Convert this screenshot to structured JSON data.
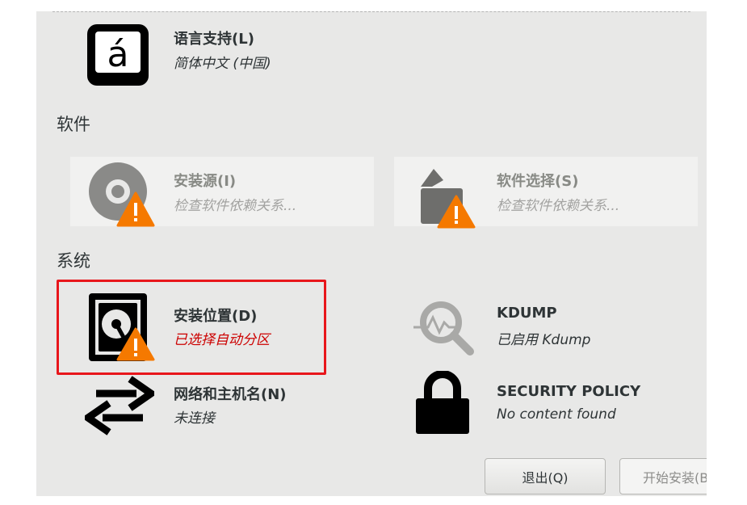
{
  "localization": {
    "language_support": {
      "title": "语言支持(L)",
      "status": "简体中文 (中国)",
      "icon": "keyboard-a-acute-icon",
      "glyph": "á"
    }
  },
  "software": {
    "section_label": "软件",
    "install_source": {
      "title": "安装源(I)",
      "status": "检查软件依赖关系...",
      "icon": "disc-icon"
    },
    "software_selection": {
      "title": "软件选择(S)",
      "status": "检查软件依赖关系...",
      "icon": "package-icon"
    }
  },
  "system": {
    "section_label": "系统",
    "install_destination": {
      "title": "安装位置(D)",
      "status": "已选择自动分区",
      "icon": "harddisk-icon"
    },
    "kdump": {
      "title": "KDUMP",
      "status": "已启用 Kdump",
      "icon": "magnifier-icon"
    },
    "network_hostname": {
      "title": "网络和主机名(N)",
      "status": "未连接",
      "icon": "network-arrows-icon"
    },
    "security_policy": {
      "title": "SECURITY POLICY",
      "status": "No content found",
      "icon": "lock-icon"
    }
  },
  "footer": {
    "quit_label": "退出(Q)",
    "begin_install_label": "开始安装(B)"
  },
  "colors": {
    "warning": "#f57900",
    "error_text": "#cc0000",
    "highlight": "#e8161b"
  }
}
